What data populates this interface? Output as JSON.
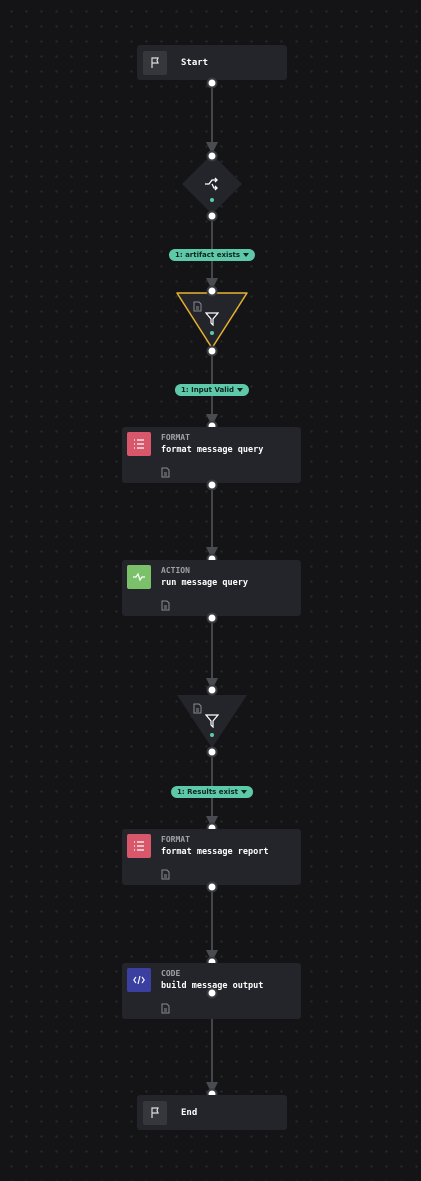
{
  "nodes": {
    "start": {
      "label": "Start"
    },
    "decision": {
      "icon": "shuffle-icon"
    },
    "filter1": {
      "icon": "filter-icon",
      "selected": true
    },
    "format1": {
      "type": "FORMAT",
      "name": "format message query",
      "color": "#d9576a"
    },
    "action1": {
      "type": "ACTION",
      "name": "run message query",
      "color": "#7ac16a"
    },
    "filter2": {
      "icon": "filter-icon"
    },
    "format2": {
      "type": "FORMAT",
      "name": "format message report",
      "color": "#d9576a"
    },
    "code1": {
      "type": "CODE",
      "name": "build message output",
      "color": "#3a3fa0"
    },
    "end": {
      "label": "End"
    }
  },
  "edges": {
    "e1": {
      "label": "1: artifact exists"
    },
    "e2": {
      "label": "1: Input Valid"
    },
    "e3": {
      "label": "1: Results exist"
    }
  },
  "colors": {
    "accent": "#5ec9a9",
    "selected": "#e6b32e"
  }
}
